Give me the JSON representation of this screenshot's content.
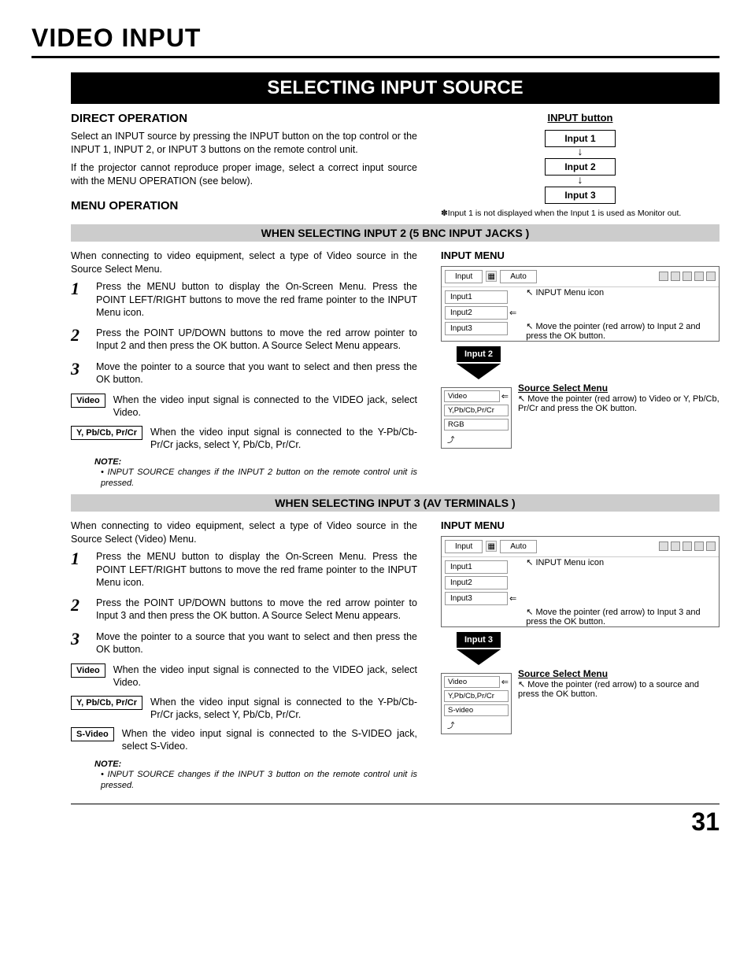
{
  "page_title": "VIDEO INPUT",
  "banner": "SELECTING INPUT SOURCE",
  "direct": {
    "heading": "DIRECT OPERATION",
    "p1": "Select an INPUT source by pressing the INPUT button on the top control or the INPUT 1, INPUT 2, or INPUT 3 buttons on the remote control unit.",
    "p2": "If the projector cannot reproduce proper image, select a correct input source with the MENU OPERATION (see below)."
  },
  "input_button": {
    "title": "INPUT button",
    "items": [
      "Input 1",
      "Input 2",
      "Input 3"
    ],
    "note": "✽Input 1 is not displayed when the Input 1 is used as Monitor out."
  },
  "menu_heading": "MENU OPERATION",
  "bar1": "WHEN SELECTING INPUT 2 (5 BNC INPUT JACKS )",
  "sec2": {
    "intro": "When connecting to video equipment, select a type of Video source in the Source Select Menu.",
    "steps": [
      "Press the MENU button to display the On-Screen Menu. Press the POINT LEFT/RIGHT buttons to move the red frame pointer to the INPUT Menu icon.",
      "Press the POINT UP/DOWN buttons to move the red arrow pointer to Input 2 and then press the OK button. A Source Select Menu appears.",
      "Move the pointer to a source that you want to select and then press the OK button."
    ],
    "opts": [
      {
        "label": "Video",
        "text": "When the video input signal is connected to the VIDEO jack, select Video."
      },
      {
        "label": "Y, Pb/Cb, Pr/Cr",
        "text": "When the video input signal is connected to the Y-Pb/Cb-Pr/Cr jacks, select Y, Pb/Cb, Pr/Cr."
      }
    ],
    "note_label": "NOTE:",
    "note": "• INPUT SOURCE changes if the INPUT 2 button on the remote control unit is pressed.",
    "menu": {
      "title": "INPUT MENU",
      "header_input": "Input",
      "header_auto": "Auto",
      "items": [
        "Input1",
        "Input2",
        "Input3"
      ],
      "icon_label": "INPUT Menu icon",
      "annot": "Move the pointer (red arrow) to Input 2 and press the OK button.",
      "arrow_label": "Input 2",
      "source_title": "Source Select Menu",
      "source_items": [
        "Video",
        "Y,Pb/Cb,Pr/Cr",
        "RGB"
      ],
      "source_annot": "Move the pointer (red arrow) to Video or Y, Pb/Cb, Pr/Cr and press the OK button."
    }
  },
  "bar2": "WHEN SELECTING INPUT 3 (AV TERMINALS )",
  "sec3": {
    "intro": "When connecting to video equipment, select a type of Video source in the Source Select (Video) Menu.",
    "steps": [
      "Press the MENU button to display the On-Screen Menu. Press the POINT LEFT/RIGHT buttons to move the red frame pointer to the INPUT Menu icon.",
      "Press the POINT UP/DOWN buttons to move the red arrow pointer to Input 3 and then press the OK button. A Source Select Menu appears.",
      "Move the pointer to a source that you want to select and then press the OK button."
    ],
    "opts": [
      {
        "label": "Video",
        "text": "When the video input signal is connected to the VIDEO jack, select Video."
      },
      {
        "label": "Y, Pb/Cb, Pr/Cr",
        "text": "When the video input signal is connected to the Y-Pb/Cb-Pr/Cr jacks, select Y, Pb/Cb, Pr/Cr."
      },
      {
        "label": "S-Video",
        "text": "When the video input signal is connected to the S-VIDEO jack, select S-Video."
      }
    ],
    "note_label": "NOTE:",
    "note": "• INPUT SOURCE changes if the INPUT 3 button on the remote control unit is pressed.",
    "menu": {
      "title": "INPUT MENU",
      "header_input": "Input",
      "header_auto": "Auto",
      "items": [
        "Input1",
        "Input2",
        "Input3"
      ],
      "icon_label": "INPUT Menu icon",
      "annot": "Move the pointer (red arrow) to Input 3 and press the OK button.",
      "arrow_label": "Input 3",
      "source_title": "Source Select Menu",
      "source_items": [
        "Video",
        "Y,Pb/Cb,Pr/Cr",
        "S-video"
      ],
      "source_annot": "Move the pointer (red arrow) to a source and press the OK button."
    }
  },
  "page_number": "31"
}
